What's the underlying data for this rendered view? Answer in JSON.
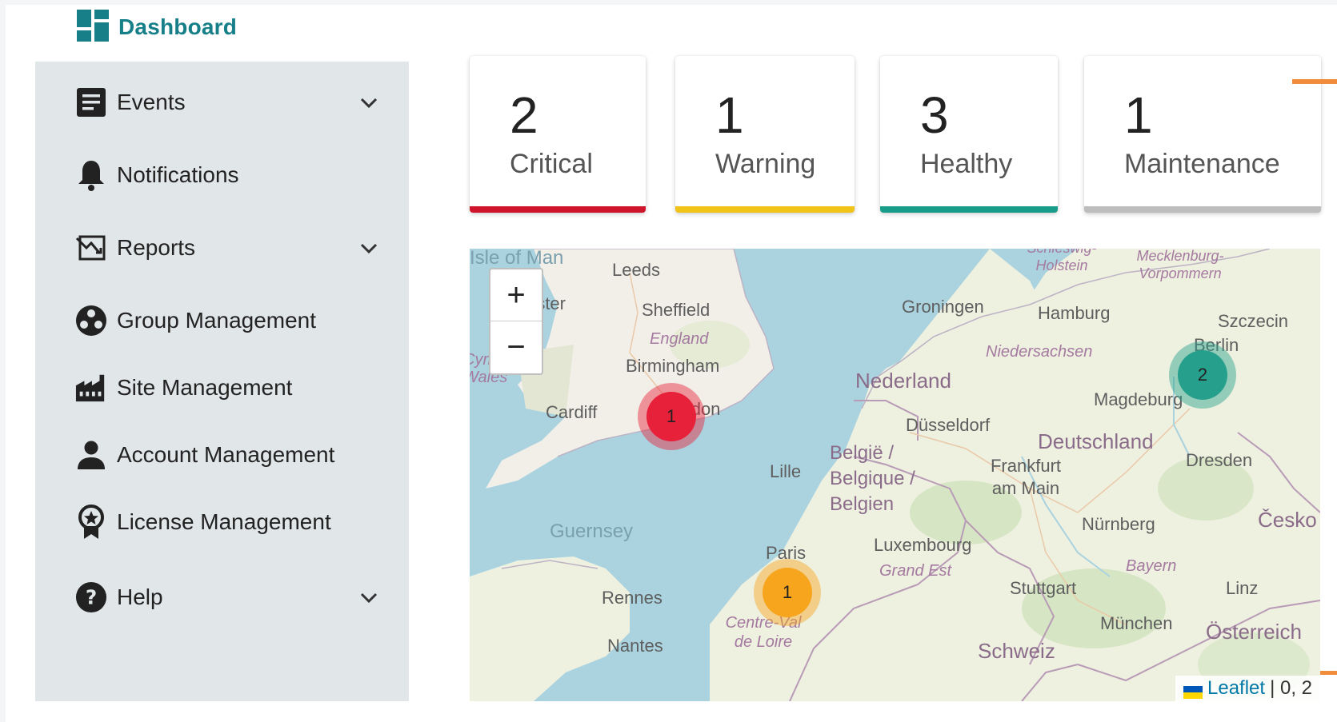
{
  "header": {
    "title": "Dashboard",
    "icon": "dashboard-icon",
    "color": "#167f87"
  },
  "sidebar": {
    "items": [
      {
        "label": "Events",
        "icon": "event-list-icon",
        "expandable": true
      },
      {
        "label": "Notifications",
        "icon": "bell-icon",
        "expandable": false
      },
      {
        "label": "Reports",
        "icon": "report-icon",
        "expandable": true
      },
      {
        "label": "Group Management",
        "icon": "group-icon",
        "expandable": false
      },
      {
        "label": "Site Management",
        "icon": "factory-icon",
        "expandable": false
      },
      {
        "label": "Account Management",
        "icon": "person-icon",
        "expandable": false
      },
      {
        "label": "License Management",
        "icon": "license-badge-icon",
        "expandable": false
      },
      {
        "label": "Help",
        "icon": "help-icon",
        "expandable": true
      }
    ]
  },
  "status_cards": [
    {
      "count": "2",
      "label": "Critical",
      "color": "#d0142c"
    },
    {
      "count": "1",
      "label": "Warning",
      "color": "#f0c419"
    },
    {
      "count": "3",
      "label": "Healthy",
      "color": "#1a9c8a"
    },
    {
      "count": "1",
      "label": "Maintenance",
      "color": "#bdbdbd"
    }
  ],
  "map": {
    "zoom_in": "+",
    "zoom_out": "−",
    "attribution_link": "Leaflet",
    "attribution_text": "| 0, 2",
    "clusters": [
      {
        "count": "1",
        "status": "critical",
        "color": "#e8213a"
      },
      {
        "count": "1",
        "status": "warning",
        "color": "#f7a51c"
      },
      {
        "count": "2",
        "status": "healthy",
        "color": "#26a08c"
      }
    ],
    "labels": [
      "Isle of Man",
      "Leeds",
      "Manchester",
      "Sheffield",
      "England",
      "Birmingham",
      "Cymru / Wales",
      "Cardiff",
      "London",
      "Groningen",
      "Hamburg",
      "Szczecin",
      "Niedersachsen",
      "Berlin",
      "Nederland",
      "Magdeburg",
      "Düsseldorf",
      "Deutschland",
      "België / Belgique / Belgien",
      "Lille",
      "Frankfurt am Main",
      "Dresden",
      "Guernsey",
      "Nürnberg",
      "Česko",
      "Luxembourg",
      "Paris",
      "Grand Est",
      "Bayern",
      "Stuttgart",
      "Linz",
      "Rennes",
      "Centre-Val de Loire",
      "München",
      "Österreich",
      "Nantes",
      "Schweiz",
      "Schleswig-Holstein",
      "Mecklenburg-Vorpommern"
    ]
  }
}
